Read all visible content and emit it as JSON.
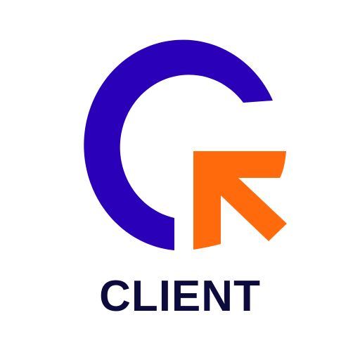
{
  "logo": {
    "wordmark": "CLIENT",
    "mark_icon": "c-with-arrow-cursor-icon",
    "colors": {
      "ring": "#2a00b8",
      "arrow": "#ff6a0d",
      "wordmark": "#0d0a3d",
      "background": "#ffffff"
    }
  }
}
